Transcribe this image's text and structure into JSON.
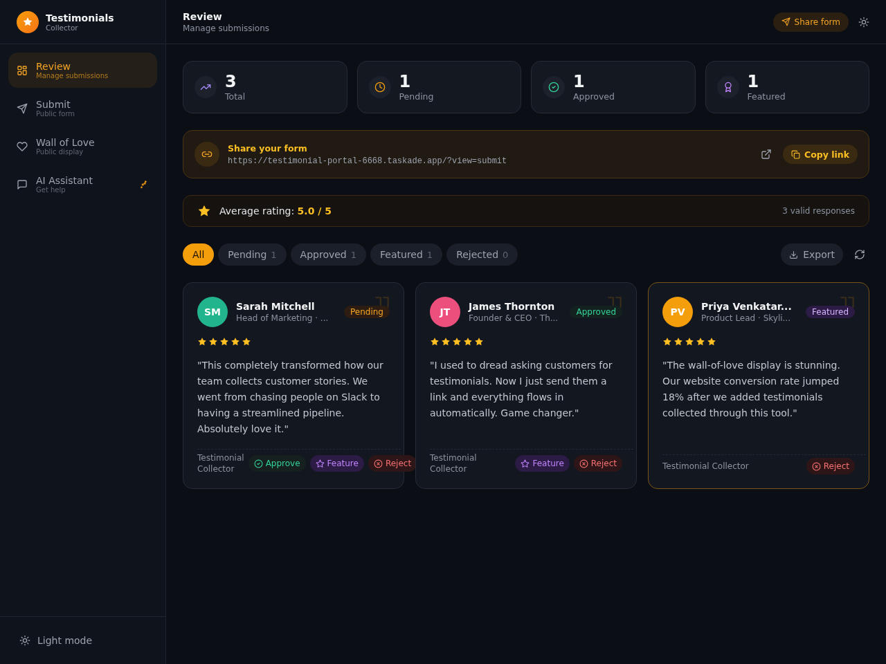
{
  "brand": {
    "title": "Testimonials",
    "subtitle": "Collector"
  },
  "sidebar": {
    "items": [
      {
        "kind": "grid",
        "label": "Review",
        "sub": "Manage submissions",
        "selected": true,
        "sparkle": false
      },
      {
        "kind": "send",
        "label": "Submit",
        "sub": "Public form",
        "selected": false,
        "sparkle": false
      },
      {
        "kind": "heart",
        "label": "Wall of Love",
        "sub": "Public display",
        "selected": false,
        "sparkle": false
      },
      {
        "kind": "chat",
        "label": "AI Assistant",
        "sub": "Get help",
        "selected": false,
        "sparkle": true
      }
    ],
    "footer": "Light mode"
  },
  "header": {
    "title": "Review",
    "subtitle": "Manage submissions",
    "share_button": "Share form"
  },
  "stats": [
    {
      "kind": "trend",
      "value": "3",
      "label": "Total"
    },
    {
      "kind": "clock",
      "value": "1",
      "label": "Pending"
    },
    {
      "kind": "check",
      "value": "1",
      "label": "Approved"
    },
    {
      "kind": "award",
      "value": "1",
      "label": "Featured"
    }
  ],
  "share": {
    "title": "Share your form",
    "url": "https://testimonial-portal-6668.taskade.app/?view=submit",
    "copy_button": "Copy link"
  },
  "rating": {
    "text": "Average rating: **5.0 / 5**",
    "responses": "3 valid responses"
  },
  "filters": [
    {
      "label": "All",
      "selected": true
    },
    {
      "label": "Pending",
      "count": "1",
      "selected": false
    },
    {
      "label": "Approved",
      "count": "1",
      "selected": false
    },
    {
      "label": "Featured",
      "count": "1",
      "selected": false
    },
    {
      "label": "Rejected",
      "count": "0",
      "selected": false
    }
  ],
  "export_button": "Export",
  "cards": [
    {
      "initials": "SM",
      "color": "#22b48a",
      "name": "Sarah Mitchell",
      "role": "Head of Marketing · ...",
      "status": {
        "kind": "pending",
        "label": "Pending"
      },
      "stars": 5,
      "quote": "\"This completely transformed how our team collects customer stories. We went from chasing people on Slack to having a streamlined pipeline. Absolutely love it.\"",
      "source": "Testimonial Collector",
      "actions": [
        {
          "kind": "approve",
          "label": "Approve"
        },
        {
          "kind": "feature",
          "label": "Feature"
        },
        {
          "kind": "reject",
          "label": "Reject"
        }
      ]
    },
    {
      "initials": "JT",
      "color": "#ec4f7c",
      "name": "James Thornton",
      "role": "Founder & CEO · Th...",
      "status": {
        "kind": "approved",
        "label": "Approved"
      },
      "stars": 5,
      "quote": "\"I used to dread asking customers for testimonials. Now I just send them a link and everything flows in automatically. Game changer.\"",
      "source": "Testimonial Collector",
      "actions": [
        {
          "kind": "feature",
          "label": "Feature"
        },
        {
          "kind": "reject",
          "label": "Reject"
        }
      ]
    },
    {
      "initials": "PV",
      "color": "#f59e0b",
      "name": "Priya Venkatar...",
      "role": "Product Lead · Skyli...",
      "status": {
        "kind": "featured",
        "label": "Featured"
      },
      "stars": 5,
      "quote": "\"The wall-of-love display is stunning. Our website conversion rate jumped 18% after we added testimonials collected through this tool.\"",
      "source": "Testimonial Collector",
      "actions": [
        {
          "kind": "reject",
          "label": "Reject"
        }
      ]
    }
  ]
}
